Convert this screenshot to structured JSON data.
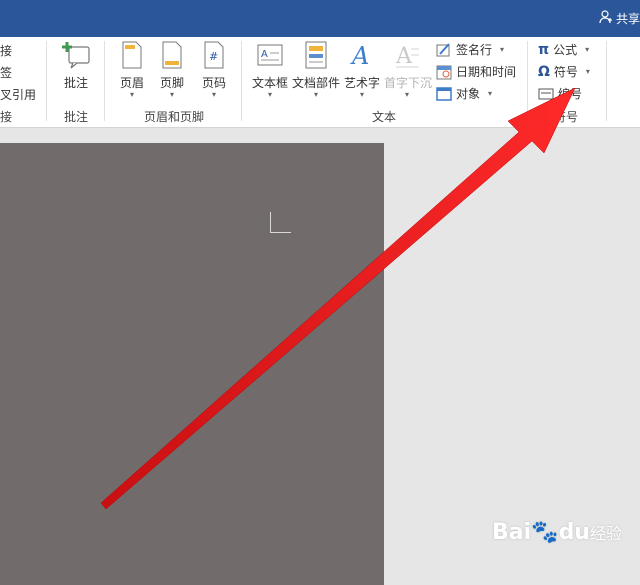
{
  "titlebar": {
    "share_label": "共享"
  },
  "ribbon": {
    "link_group": {
      "items": [
        "接",
        "签",
        "叉引用"
      ],
      "label": "链接",
      "label_visible": "接"
    },
    "comment_group": {
      "button": "批注",
      "label": "批注"
    },
    "header_footer_group": {
      "buttons": [
        "页眉",
        "页脚",
        "页码"
      ],
      "label": "页眉和页脚"
    },
    "text_group": {
      "buttons": [
        "文本框",
        "文档部件",
        "艺术字",
        "首字下沉"
      ],
      "side_items": [
        "签名行",
        "日期和时间",
        "对象"
      ],
      "label": "文本"
    },
    "symbols_group": {
      "items": [
        "公式",
        "符号",
        "编号"
      ],
      "label": "符号",
      "pi": "π",
      "omega": "Ω"
    }
  },
  "watermark": {
    "brand": "Bai",
    "brand2": "经验",
    "du": "du"
  },
  "colors": {
    "title_bar": "#2b579a",
    "doc_bg": "#716c6b",
    "arrow": "#e8161a"
  }
}
